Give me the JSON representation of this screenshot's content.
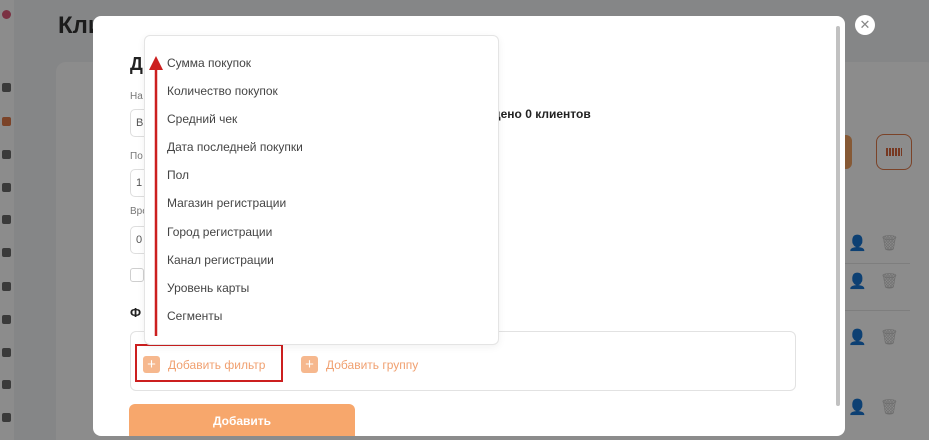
{
  "background": {
    "page_title": "Кли"
  },
  "modal": {
    "heading": "Д",
    "labels": [
      "На",
      "По",
      "Вре"
    ],
    "inputs": [
      "В",
      "1",
      "0"
    ],
    "found_text": "дено 0 клиентов",
    "section_title": "Ф",
    "add_filter_label": "Добавить фильтр",
    "add_group_label": "Добавить группу",
    "submit_label": "Добавить"
  },
  "dropdown": {
    "items": [
      "Сумма покупок",
      "Количество покупок",
      "Средний чек",
      "Дата последней покупки",
      "Пол",
      "Магазин регистрации",
      "Город регистрации",
      "Канал регистрации",
      "Уровень карты",
      "Сегменты"
    ]
  },
  "colors": {
    "accent": "#f7a76c",
    "highlight": "#cc1f1f"
  }
}
